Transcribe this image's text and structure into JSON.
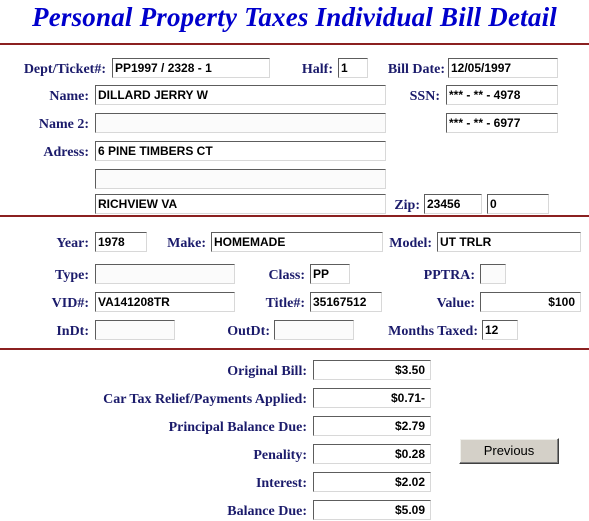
{
  "page": {
    "title": "Personal Property Taxes Individual Bill Detail",
    "title_color": "#0000CC",
    "label_color": "#1B1B6B",
    "divider_color": "#8B2020"
  },
  "section_bill": {
    "dept_ticket_label": "Dept/Ticket#:",
    "dept_ticket_value": "PP1997 / 2328 - 1",
    "half_label": "Half:",
    "half_value": "1",
    "bill_date_label": "Bill Date:",
    "bill_date_value": "12/05/1997",
    "name_label": "Name:",
    "name_value": "DILLARD JERRY W",
    "ssn_label": "SSN:",
    "ssn_value_1": "*** - ** - 4978",
    "ssn_value_2": "*** - ** - 6977",
    "name2_label": "Name 2:",
    "name2_value": "",
    "address_label": "Adress:",
    "address_line1": "6 PINE TIMBERS CT",
    "address_line2": "",
    "address_line3": "RICHVIEW VA",
    "zip_label": "Zip:",
    "zip_value": "23456",
    "zip_ext_value": "0"
  },
  "section_property": {
    "year_label": "Year:",
    "year_value": "1978",
    "make_label": "Make:",
    "make_value": "HOMEMADE",
    "model_label": "Model:",
    "model_value": "UT TRLR",
    "type_label": "Type:",
    "type_value": "",
    "class_label": "Class:",
    "class_value": "PP",
    "pptra_label": "PPTRA:",
    "pptra_value": "",
    "vid_label": "VID#:",
    "vid_value": "VA141208TR",
    "title_num_label": "Title#:",
    "title_num_value": "35167512",
    "value_label": "Value:",
    "value_value": "$100",
    "indt_label": "InDt:",
    "indt_value": "",
    "outdt_label": "OutDt:",
    "outdt_value": "",
    "months_taxed_label": "Months Taxed:",
    "months_taxed_value": "12"
  },
  "section_totals": {
    "original_bill_label": "Original Bill:",
    "original_bill_value": "$3.50",
    "car_tax_relief_label": "Car Tax Relief/Payments Applied:",
    "car_tax_relief_value": "$0.71-",
    "principal_balance_label": "Principal Balance Due:",
    "principal_balance_value": "$2.79",
    "penality_label": "Penality:",
    "penality_value": "$0.28",
    "interest_label": "Interest:",
    "interest_value": "$2.02",
    "balance_due_label": "Balance Due:",
    "balance_due_value": "$5.09"
  },
  "actions": {
    "previous_label": "Previous"
  }
}
